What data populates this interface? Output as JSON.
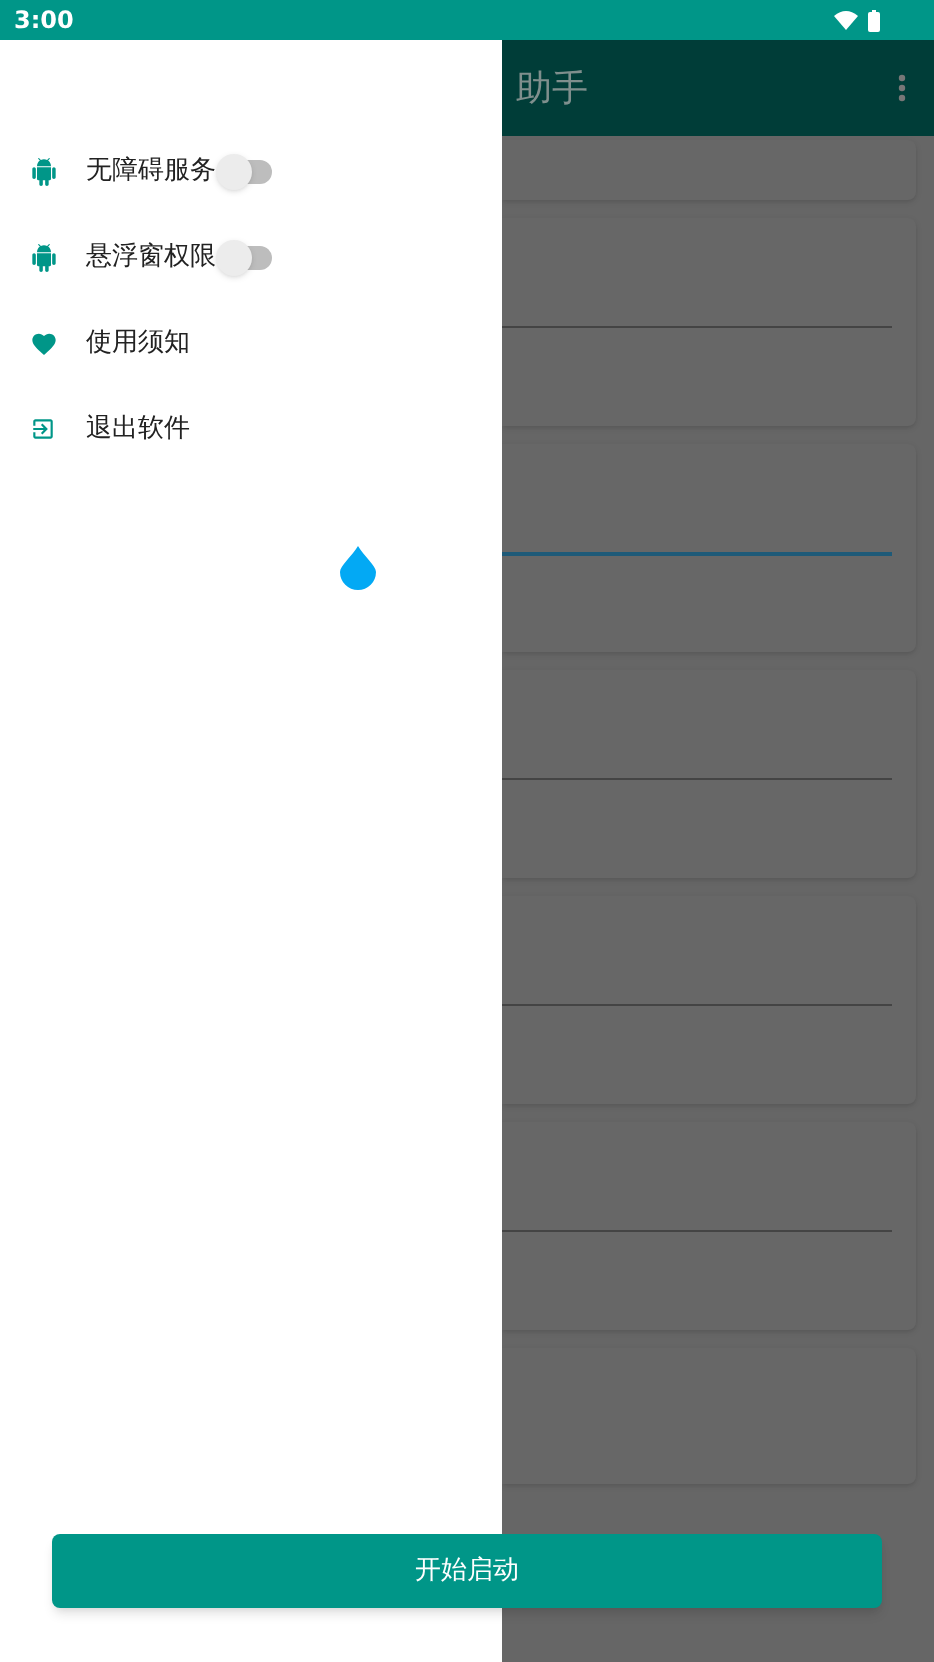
{
  "status_bar": {
    "time": "3:00"
  },
  "app_bar": {
    "title": "助手"
  },
  "drawer": {
    "items": [
      {
        "kind": "switch",
        "label": "无障碍服务",
        "on": false
      },
      {
        "kind": "switch",
        "label": "悬浮窗权限",
        "on": false
      },
      {
        "kind": "link",
        "label": "使用须知"
      },
      {
        "kind": "link",
        "label": "退出软件"
      }
    ]
  },
  "cards": [
    {
      "kind": "plain"
    },
    {
      "kind": "field",
      "focused": false
    },
    {
      "kind": "field",
      "focused": true
    },
    {
      "kind": "field",
      "focused": false
    },
    {
      "kind": "field",
      "focused": false
    },
    {
      "kind": "field",
      "focused": false
    },
    {
      "kind": "plain"
    }
  ],
  "start_button": {
    "label": "开始启动"
  }
}
